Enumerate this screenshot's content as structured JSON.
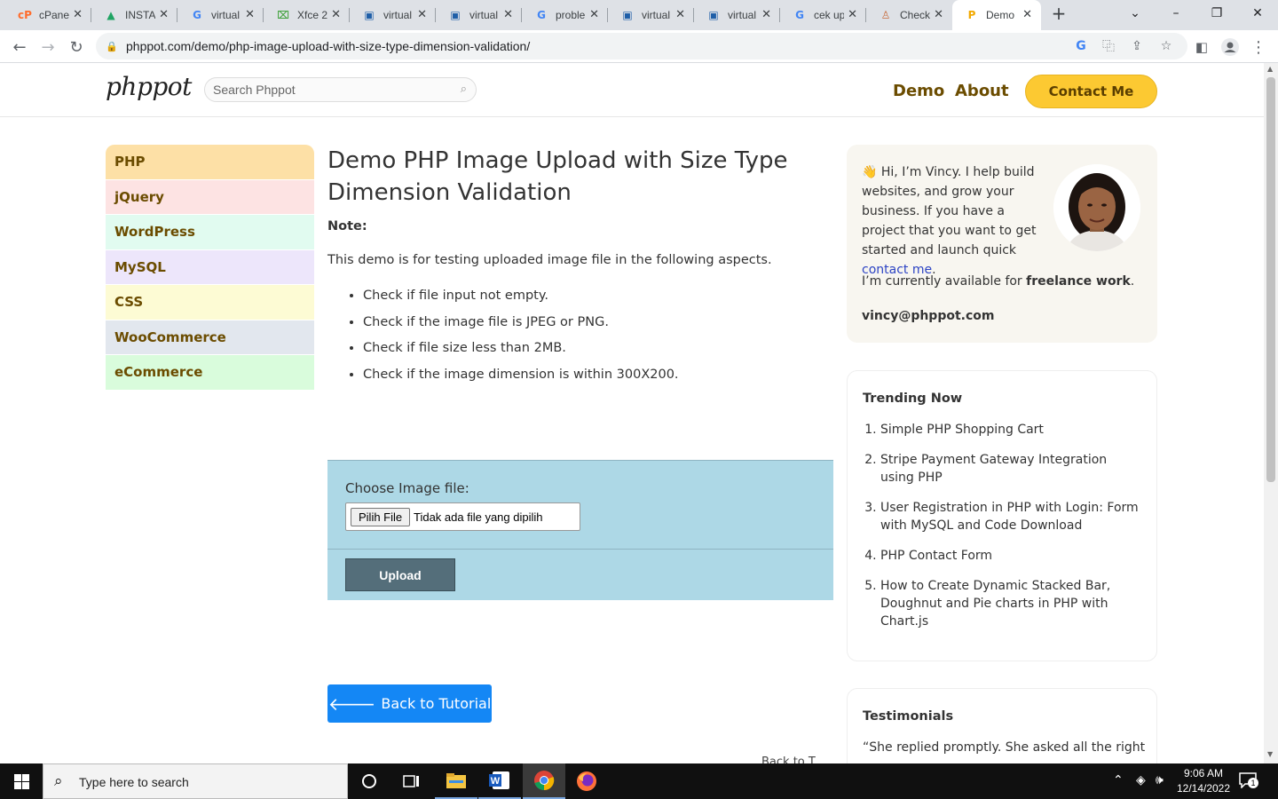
{
  "browser": {
    "tabs": [
      {
        "title": "cPanel",
        "icon": "cpanel-icon",
        "color": "#ff6c2c",
        "glyph": "cP"
      },
      {
        "title": "INSTA",
        "icon": "google-drive-icon",
        "color": "#1fa463",
        "glyph": "▲"
      },
      {
        "title": "virtual",
        "icon": "google-icon",
        "color": "#4285f4",
        "glyph": "G"
      },
      {
        "title": "Xfce 2",
        "icon": "xfce-icon",
        "color": "#44a340",
        "glyph": "⌧"
      },
      {
        "title": "virtual",
        "icon": "virtualbox-icon",
        "color": "#1f5fa8",
        "glyph": "▣"
      },
      {
        "title": "virtual",
        "icon": "virtualbox-icon",
        "color": "#1f5fa8",
        "glyph": "▣"
      },
      {
        "title": "proble",
        "icon": "google-icon",
        "color": "#4285f4",
        "glyph": "G"
      },
      {
        "title": "virtual",
        "icon": "virtualbox-icon",
        "color": "#1f5fa8",
        "glyph": "▣"
      },
      {
        "title": "virtual",
        "icon": "virtualbox-icon",
        "color": "#1f5fa8",
        "glyph": "▣"
      },
      {
        "title": "cek up",
        "icon": "google-icon",
        "color": "#4285f4",
        "glyph": "G"
      },
      {
        "title": "Check",
        "icon": "check-site-icon",
        "color": "#c76a3a",
        "glyph": "♙"
      },
      {
        "title": "Demo",
        "icon": "phppot-icon",
        "color": "#f2a900",
        "glyph": "P",
        "active": true
      }
    ],
    "new_tab": "+",
    "url": "phppot.com/demo/php-image-upload-with-size-type-dimension-validation/"
  },
  "site": {
    "logo": "phppot",
    "search_placeholder": "Search Phppot",
    "nav": {
      "demo": "Demo",
      "about": "About",
      "contact": "Contact Me"
    },
    "categories": [
      {
        "label": "PHP",
        "bg": "#fde0a6"
      },
      {
        "label": "jQuery",
        "bg": "#fde3e3"
      },
      {
        "label": "WordPress",
        "bg": "#e1fbf0"
      },
      {
        "label": "MySQL",
        "bg": "#ede6fb"
      },
      {
        "label": "CSS",
        "bg": "#fdfbd4"
      },
      {
        "label": "WooCommerce",
        "bg": "#e2e7ee"
      },
      {
        "label": "eCommerce",
        "bg": "#d9fcdc"
      }
    ],
    "main": {
      "title": "Demo PHP Image Upload with Size Type Dimension Validation",
      "note_label": "Note:",
      "note_text": "This demo is for testing uploaded image file in the following aspects.",
      "checks": [
        "Check if file input not empty.",
        "Check if the image file is JPEG or PNG.",
        "Check if file size less than 2MB.",
        "Check if the image dimension is within 300X200."
      ],
      "form": {
        "label": "Choose Image file:",
        "file_button": "Pilih File",
        "file_status": "Tidak ada file yang dipilih",
        "submit": "Upload"
      },
      "back_button": "Back to Tutorial",
      "partial_text": "Back to T"
    },
    "sidebar": {
      "intro_emoji": "👋",
      "intro_text": "Hi, I’m Vincy. I help build websites, and grow your business. If you have a project that you want to get started and launch quick",
      "intro_link": "contact me",
      "intro_end": ".",
      "avail_prefix": "I’m currently available for",
      "avail_bold": "freelance work",
      "avail_end": ".",
      "email": "vincy@phppot.com",
      "trending_title": "Trending Now",
      "trending": [
        "Simple PHP Shopping Cart",
        "Stripe Payment Gateway Integration using PHP",
        "User Registration in PHP with Login: Form with MySQL and Code Download",
        "PHP Contact Form",
        "How to Create Dynamic Stacked Bar, Doughnut and Pie charts in PHP with Chart.js"
      ],
      "testimonials_title": "Testimonials",
      "testimonial_quote": "“She replied promptly. She asked all the right"
    }
  },
  "taskbar": {
    "search_placeholder": "Type here to search",
    "time": "9:06 AM",
    "date": "12/14/2022",
    "notification_count": "1"
  }
}
